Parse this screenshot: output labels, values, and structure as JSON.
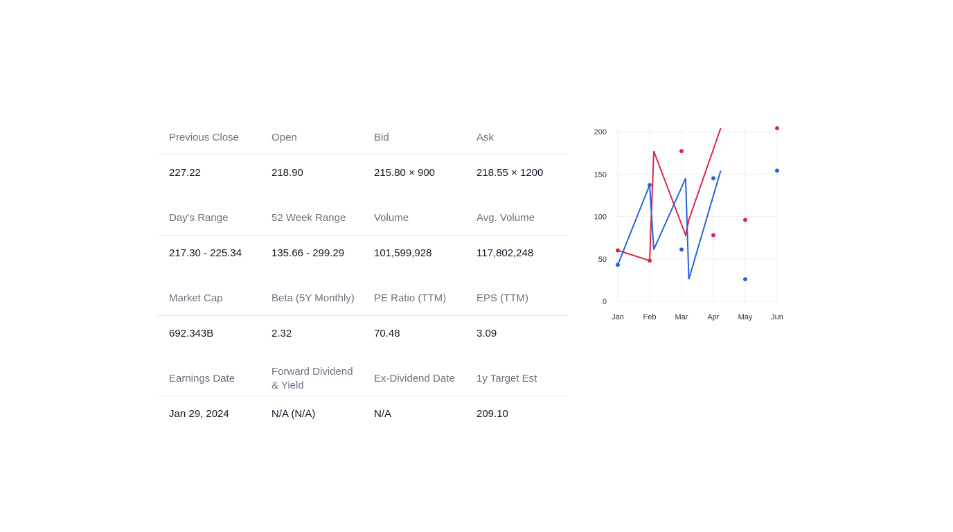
{
  "stats": {
    "rows": [
      {
        "labels": [
          "Previous Close",
          "Open",
          "Bid",
          "Ask"
        ],
        "values": [
          "227.22",
          "218.90",
          "215.80 × 900",
          "218.55 × 1200"
        ]
      },
      {
        "labels": [
          "Day's Range",
          "52 Week Range",
          "Volume",
          "Avg. Volume"
        ],
        "values": [
          "217.30 - 225.34",
          "135.66 - 299.29",
          "101,599,928",
          "117,802,248"
        ]
      },
      {
        "labels": [
          "Market Cap",
          "Beta (5Y Monthly)",
          "PE Ratio (TTM)",
          "EPS (TTM)"
        ],
        "values": [
          "692.343B",
          "2.32",
          "70.48",
          "3.09"
        ]
      },
      {
        "labels": [
          "Earnings Date",
          "Forward Dividend & Yield",
          "Ex-Dividend Date",
          "1y Target Est"
        ],
        "values": [
          "Jan 29, 2024",
          "N/A (N/A)",
          "N/A",
          "209.10"
        ]
      }
    ]
  },
  "chart_data": {
    "type": "line",
    "categories": [
      "Jan",
      "Feb",
      "Mar",
      "Apr",
      "May",
      "Jun"
    ],
    "yticks": [
      "0",
      "50",
      "100",
      "150",
      "200"
    ],
    "ylim": [
      0,
      200
    ],
    "grid": true,
    "series": [
      {
        "color": "#dc2648",
        "points": [
          60,
          48,
          177,
          78,
          96,
          204
        ],
        "line": [
          {
            "x": 0.0,
            "y": 60
          },
          {
            "x": 1.0,
            "y": 48
          },
          {
            "x": 1.13,
            "y": 177
          },
          {
            "x": 2.13,
            "y": 78
          },
          {
            "x": 2.23,
            "y": 96
          },
          {
            "x": 3.23,
            "y": 204
          }
        ]
      },
      {
        "color": "#2563d9",
        "points": [
          43,
          137,
          61,
          145,
          26,
          154
        ],
        "line": [
          {
            "x": 0.0,
            "y": 43
          },
          {
            "x": 1.0,
            "y": 137
          },
          {
            "x": 1.13,
            "y": 61
          },
          {
            "x": 2.13,
            "y": 145
          },
          {
            "x": 2.23,
            "y": 26
          },
          {
            "x": 3.23,
            "y": 154
          }
        ]
      }
    ]
  }
}
